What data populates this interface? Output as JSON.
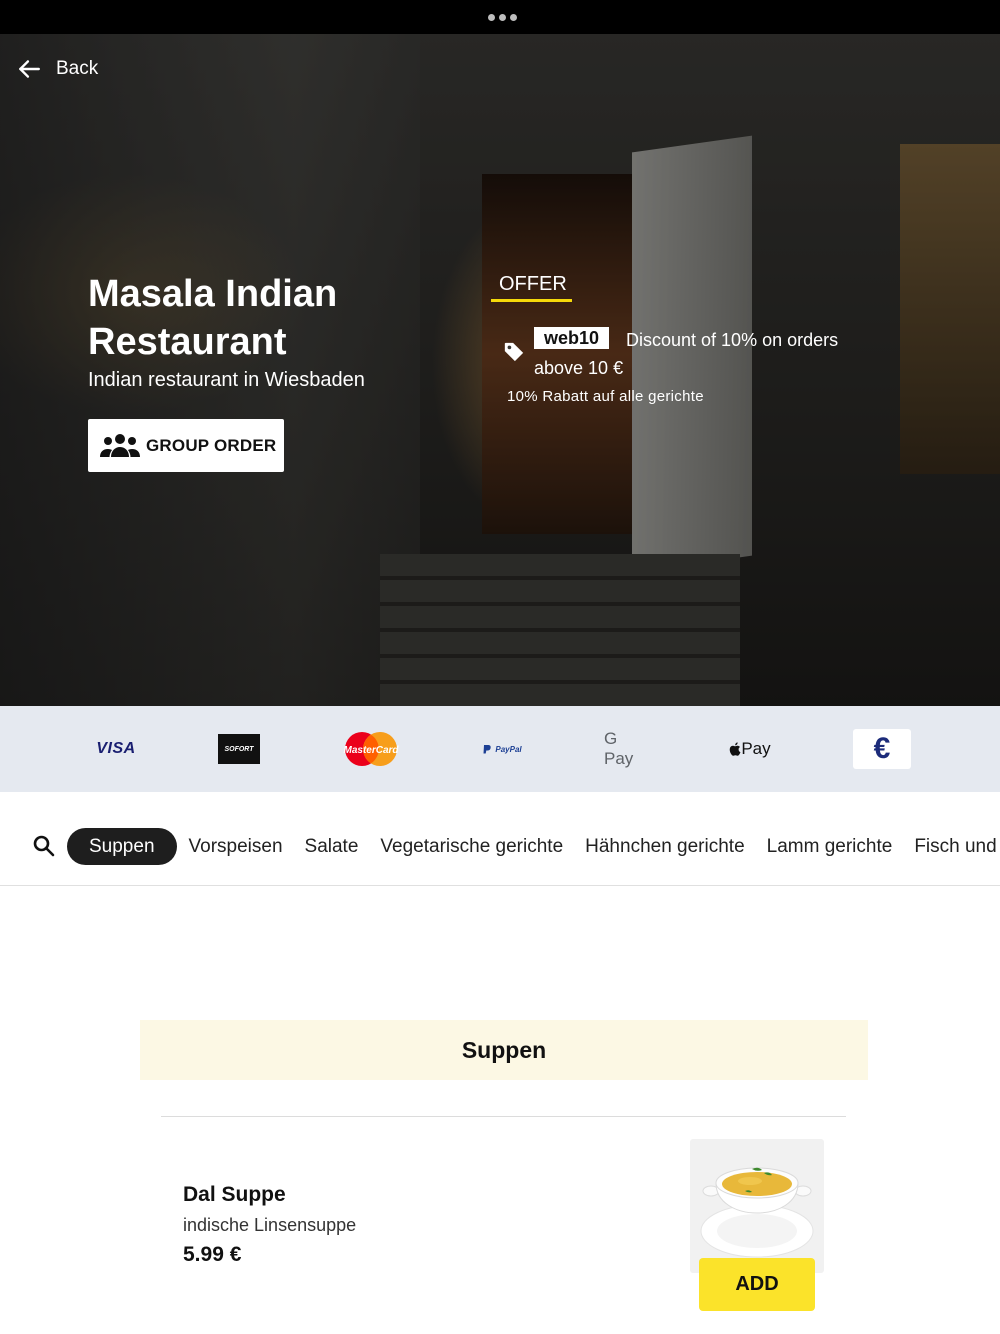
{
  "back": {
    "label": "Back"
  },
  "restaurant": {
    "name": "Masala Indian Restaurant",
    "subtitle": "Indian restaurant in Wiesbaden",
    "group_order_label": "GROUP ORDER"
  },
  "offer": {
    "label": "OFFER",
    "code": "web10",
    "description": "Discount of 10% on orders above 10 €",
    "note": "10% Rabatt auf alle gerichte",
    "accent_color": "#f5d90a"
  },
  "payment_methods": [
    {
      "name": "visa-logo",
      "text": "VISA"
    },
    {
      "name": "sofort-logo",
      "text": "SOFORT"
    },
    {
      "name": "mastercard-logo",
      "text": "MasterCard"
    },
    {
      "name": "paypal-logo",
      "text": "PayPal"
    },
    {
      "name": "google-pay-logo",
      "text": "G Pay"
    },
    {
      "name": "apple-pay-logo",
      "text": "Pay"
    },
    {
      "name": "cash-euro-icon",
      "text": "€"
    }
  ],
  "categories": [
    {
      "label": "Suppen",
      "active": true
    },
    {
      "label": "Vorspeisen"
    },
    {
      "label": "Salate"
    },
    {
      "label": "Vegetarische gerichte"
    },
    {
      "label": "Hähnchen gerichte"
    },
    {
      "label": "Lamm gerichte"
    },
    {
      "label": "Fisch und"
    }
  ],
  "section": {
    "title": "Suppen"
  },
  "items": [
    {
      "name": "Dal Suppe",
      "description": "indische Linsensuppe",
      "price": "5.99 €",
      "add_label": "ADD"
    }
  ],
  "colors": {
    "add_button": "#fbe32a",
    "section_header_bg": "#fcf8e4",
    "payments_bar_bg": "#e5e9f0",
    "active_category_bg": "#1e1e1e"
  }
}
